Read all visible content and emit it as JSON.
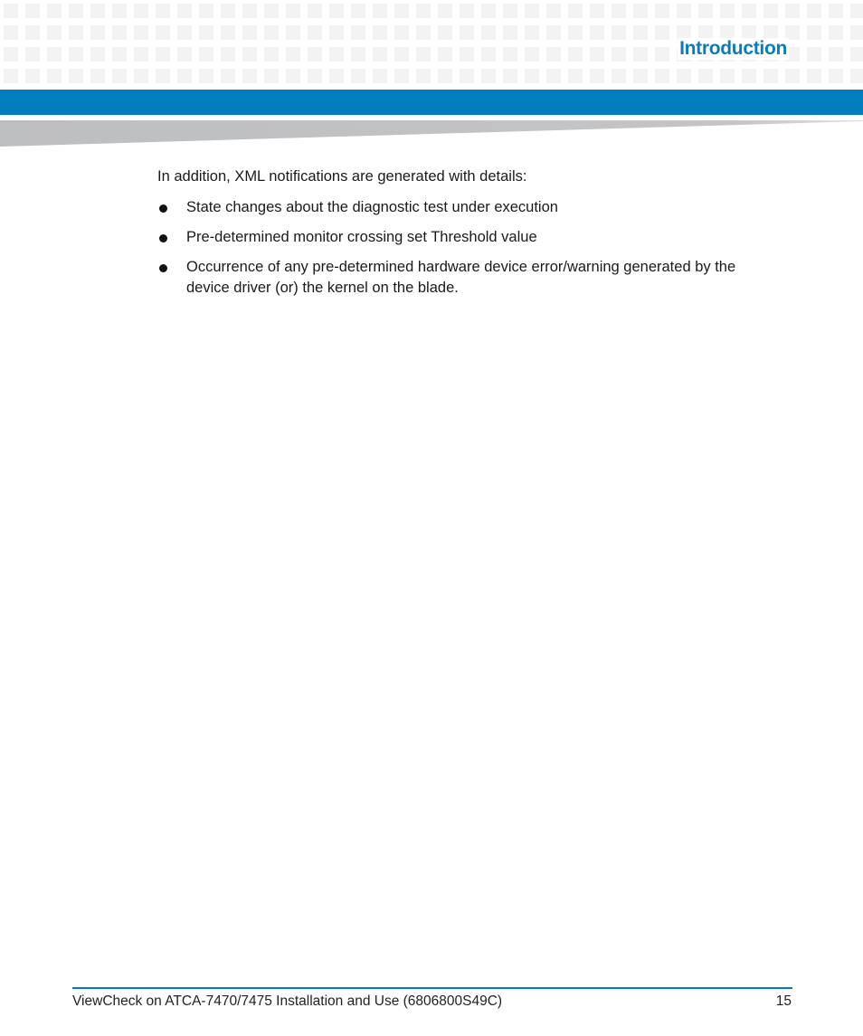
{
  "header": {
    "section_title": "Introduction",
    "accent_color": "#007dbd"
  },
  "body": {
    "intro": "In addition, XML notifications are generated with details:",
    "bullets": [
      "State changes about the diagnostic test under execution",
      "Pre-determined monitor crossing set Threshold value",
      "Occurrence of any pre-determined hardware device error/warning generated by the device driver (or) the kernel on the blade."
    ]
  },
  "footer": {
    "document_title": "ViewCheck on ATCA-7470/7475 Installation and Use (6806800S49C)",
    "page_number": "15"
  }
}
